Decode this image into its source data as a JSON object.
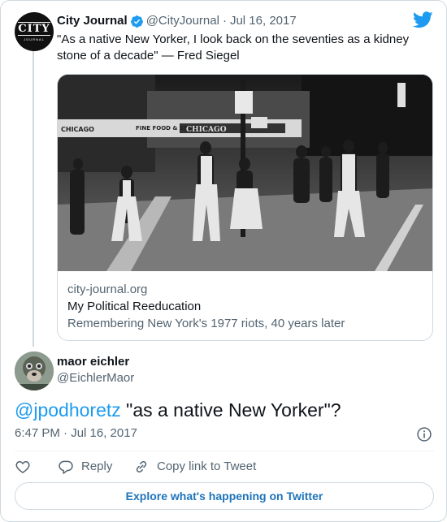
{
  "parent_tweet": {
    "avatar_text": "CITY",
    "avatar_subtext": "JOURNAL",
    "author_name": "City Journal",
    "author_handle": "@CityJournal",
    "separator": "·",
    "date": "Jul 16, 2017",
    "text": "\"As a native New Yorker, I look back on the seventies as a kidney stone of a decade\" — Fred Siegel",
    "link_card": {
      "photo_signs": [
        "CHICAGO",
        "CHICAGO",
        "FINE FOOD & SPIRITS"
      ],
      "domain": "city-journal.org",
      "title": "My Political Reeducation",
      "description": "Remembering New York's 1977 riots, 40 years later"
    }
  },
  "tweet": {
    "author_name": "maor eichler",
    "author_handle": "@EichlerMaor",
    "mention": "@jpodhoretz",
    "text": " \"as a native New Yorker\"?",
    "timestamp": "6:47 PM · Jul 16, 2017"
  },
  "actions": {
    "like_label": "",
    "reply_label": "Reply",
    "copy_label": "Copy link to Tweet"
  },
  "explore_label": "Explore what's happening on Twitter",
  "icons": {
    "verified": "verified-badge-icon",
    "brand": "twitter-bird-icon",
    "info": "info-icon",
    "like": "heart-icon",
    "reply": "reply-bubble-icon",
    "copy": "link-icon"
  },
  "colors": {
    "accent": "#1d9bf0",
    "explore_text": "#1d74bb",
    "secondary_text": "#536471",
    "border": "#cfd9de"
  }
}
